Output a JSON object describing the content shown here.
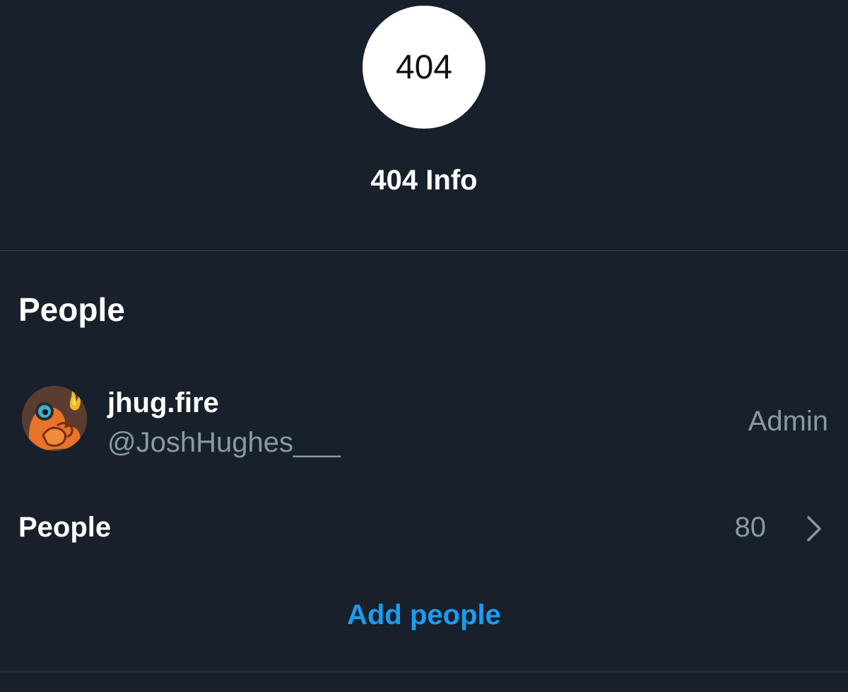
{
  "group": {
    "avatar_text": "404",
    "name": "404 Info"
  },
  "people_section": {
    "heading": "People",
    "members": [
      {
        "display_name": "jhug.fire",
        "handle": "@JoshHughes___",
        "role": "Admin"
      }
    ],
    "people_link": {
      "label": "People",
      "count": "80"
    },
    "add_people_label": "Add people"
  },
  "colors": {
    "background": "#17202b",
    "divider": "#38444d",
    "secondary_text": "#8b98a5",
    "accent": "#1d9bf0"
  },
  "icons": {
    "chevron": "chevron-right-icon"
  }
}
